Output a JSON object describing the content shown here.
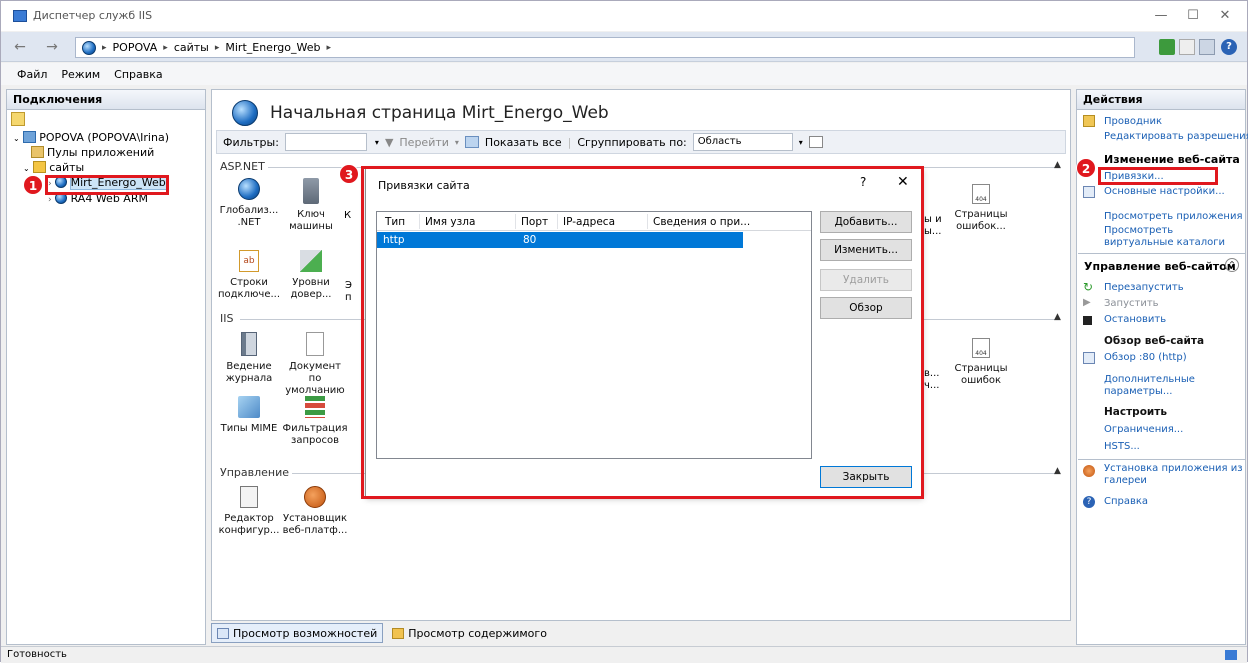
{
  "window": {
    "title": "Диспетчер служб IIS",
    "controls": {
      "minimize": "—",
      "maximize": "☐",
      "close": "✕"
    }
  },
  "address": {
    "back": "←",
    "forward": "→",
    "crumbs": [
      "POPOVA",
      "сайты",
      "Mirt_Energo_Web"
    ],
    "separator": "▸"
  },
  "menu": [
    "Файл",
    "Режим",
    "Справка"
  ],
  "connections": {
    "header": "Подключения",
    "server": "POPOVA (POPOVA\\Irina)",
    "app_pools": "Пулы приложений",
    "sites_folder": "сайты",
    "site_selected": "Mirt_Energo_Web",
    "site_other": "RA4 Web ARM"
  },
  "center": {
    "title": "Начальная страница Mirt_Energo_Web",
    "filters_label": "Фильтры:",
    "go_label": "Перейти",
    "show_all_label": "Показать все",
    "group_by_label": "Сгруппировать по:",
    "group_by_value": "Область",
    "groups": {
      "aspnet": "ASP.NET",
      "iis": "IIS",
      "management": "Управление"
    },
    "aspnet_features": [
      {
        "line1": "Глобализ...",
        "line2": ".NET",
        "icon": "globe-icon"
      },
      {
        "line1": "Ключ",
        "line2": "машины",
        "icon": "machine-key-icon"
      },
      {
        "line1": "Строки",
        "line2": "подключе...",
        "icon": "connection-strings-icon"
      },
      {
        "line1": "Уровни",
        "line2": "довер...",
        "icon": "trust-levels-icon"
      }
    ],
    "aspnet_right": {
      "partial1": "ы и",
      "partial2": "ы...",
      "line1": "Страницы",
      "line2": "ошибок...",
      "icon": "error-pages-icon"
    },
    "iis_features": [
      {
        "line1": "Ведение",
        "line2": "журнала",
        "icon": "logging-icon"
      },
      {
        "line1": "Документ по",
        "line2": "умолчанию",
        "icon": "default-document-icon"
      },
      {
        "line1": "Типы MIME",
        "line2": "",
        "icon": "mime-types-icon"
      },
      {
        "line1": "Фильтрация",
        "line2": "запросов",
        "icon": "request-filtering-icon"
      }
    ],
    "iis_right": {
      "partial1": "в...",
      "partial2": "ч...",
      "line1": "Страницы",
      "line2": "ошибок",
      "icon": "error-pages-icon"
    },
    "management_features": [
      {
        "line1": "Редактор",
        "line2": "конфигур...",
        "icon": "config-editor-icon"
      },
      {
        "line1": "Установщик",
        "line2": "веб-платф...",
        "icon": "web-platform-installer-icon"
      }
    ],
    "partial_k": "К",
    "partial_e": "Э",
    "partial_p": "п",
    "tab_features": "Просмотр возможностей",
    "tab_content": "Просмотр содержимого"
  },
  "actions": {
    "header": "Действия",
    "explore": "Проводник",
    "edit_permissions": "Редактировать разрешения...",
    "edit_site_header": "Изменение веб-сайта",
    "bindings": "Привязки...",
    "basic_settings": "Основные настройки...",
    "view_apps": "Просмотреть приложения",
    "view_vdirs": "Просмотреть виртуальные каталоги",
    "manage_site_header": "Управление веб-сайтом",
    "restart": "Перезапустить",
    "start": "Запустить",
    "stop": "Остановить",
    "browse_header": "Обзор веб-сайта",
    "browse_80": "Обзор :80 (http)",
    "advanced": "Дополнительные параметры...",
    "configure_header": "Настроить",
    "limits": "Ограничения...",
    "hsts": "HSTS...",
    "install_gallery": "Установка приложения из галереи",
    "help": "Справка"
  },
  "dialog": {
    "title": "Привязки сайта",
    "help": "?",
    "close": "✕",
    "columns": [
      "Тип",
      "Имя узла",
      "Порт",
      "IP-адреса",
      "Сведения о при..."
    ],
    "rows": [
      {
        "type": "http",
        "host": "",
        "port": "80",
        "ip": "",
        "info": ""
      }
    ],
    "buttons": {
      "add": "Добавить...",
      "edit": "Изменить...",
      "remove": "Удалить",
      "browse": "Обзор",
      "close": "Закрыть"
    }
  },
  "callouts": [
    "1",
    "2",
    "3"
  ],
  "status": "Готовность",
  "colors": {
    "callout": "#e0181e",
    "selection": "#0078d7",
    "link": "#1a5fb4"
  }
}
